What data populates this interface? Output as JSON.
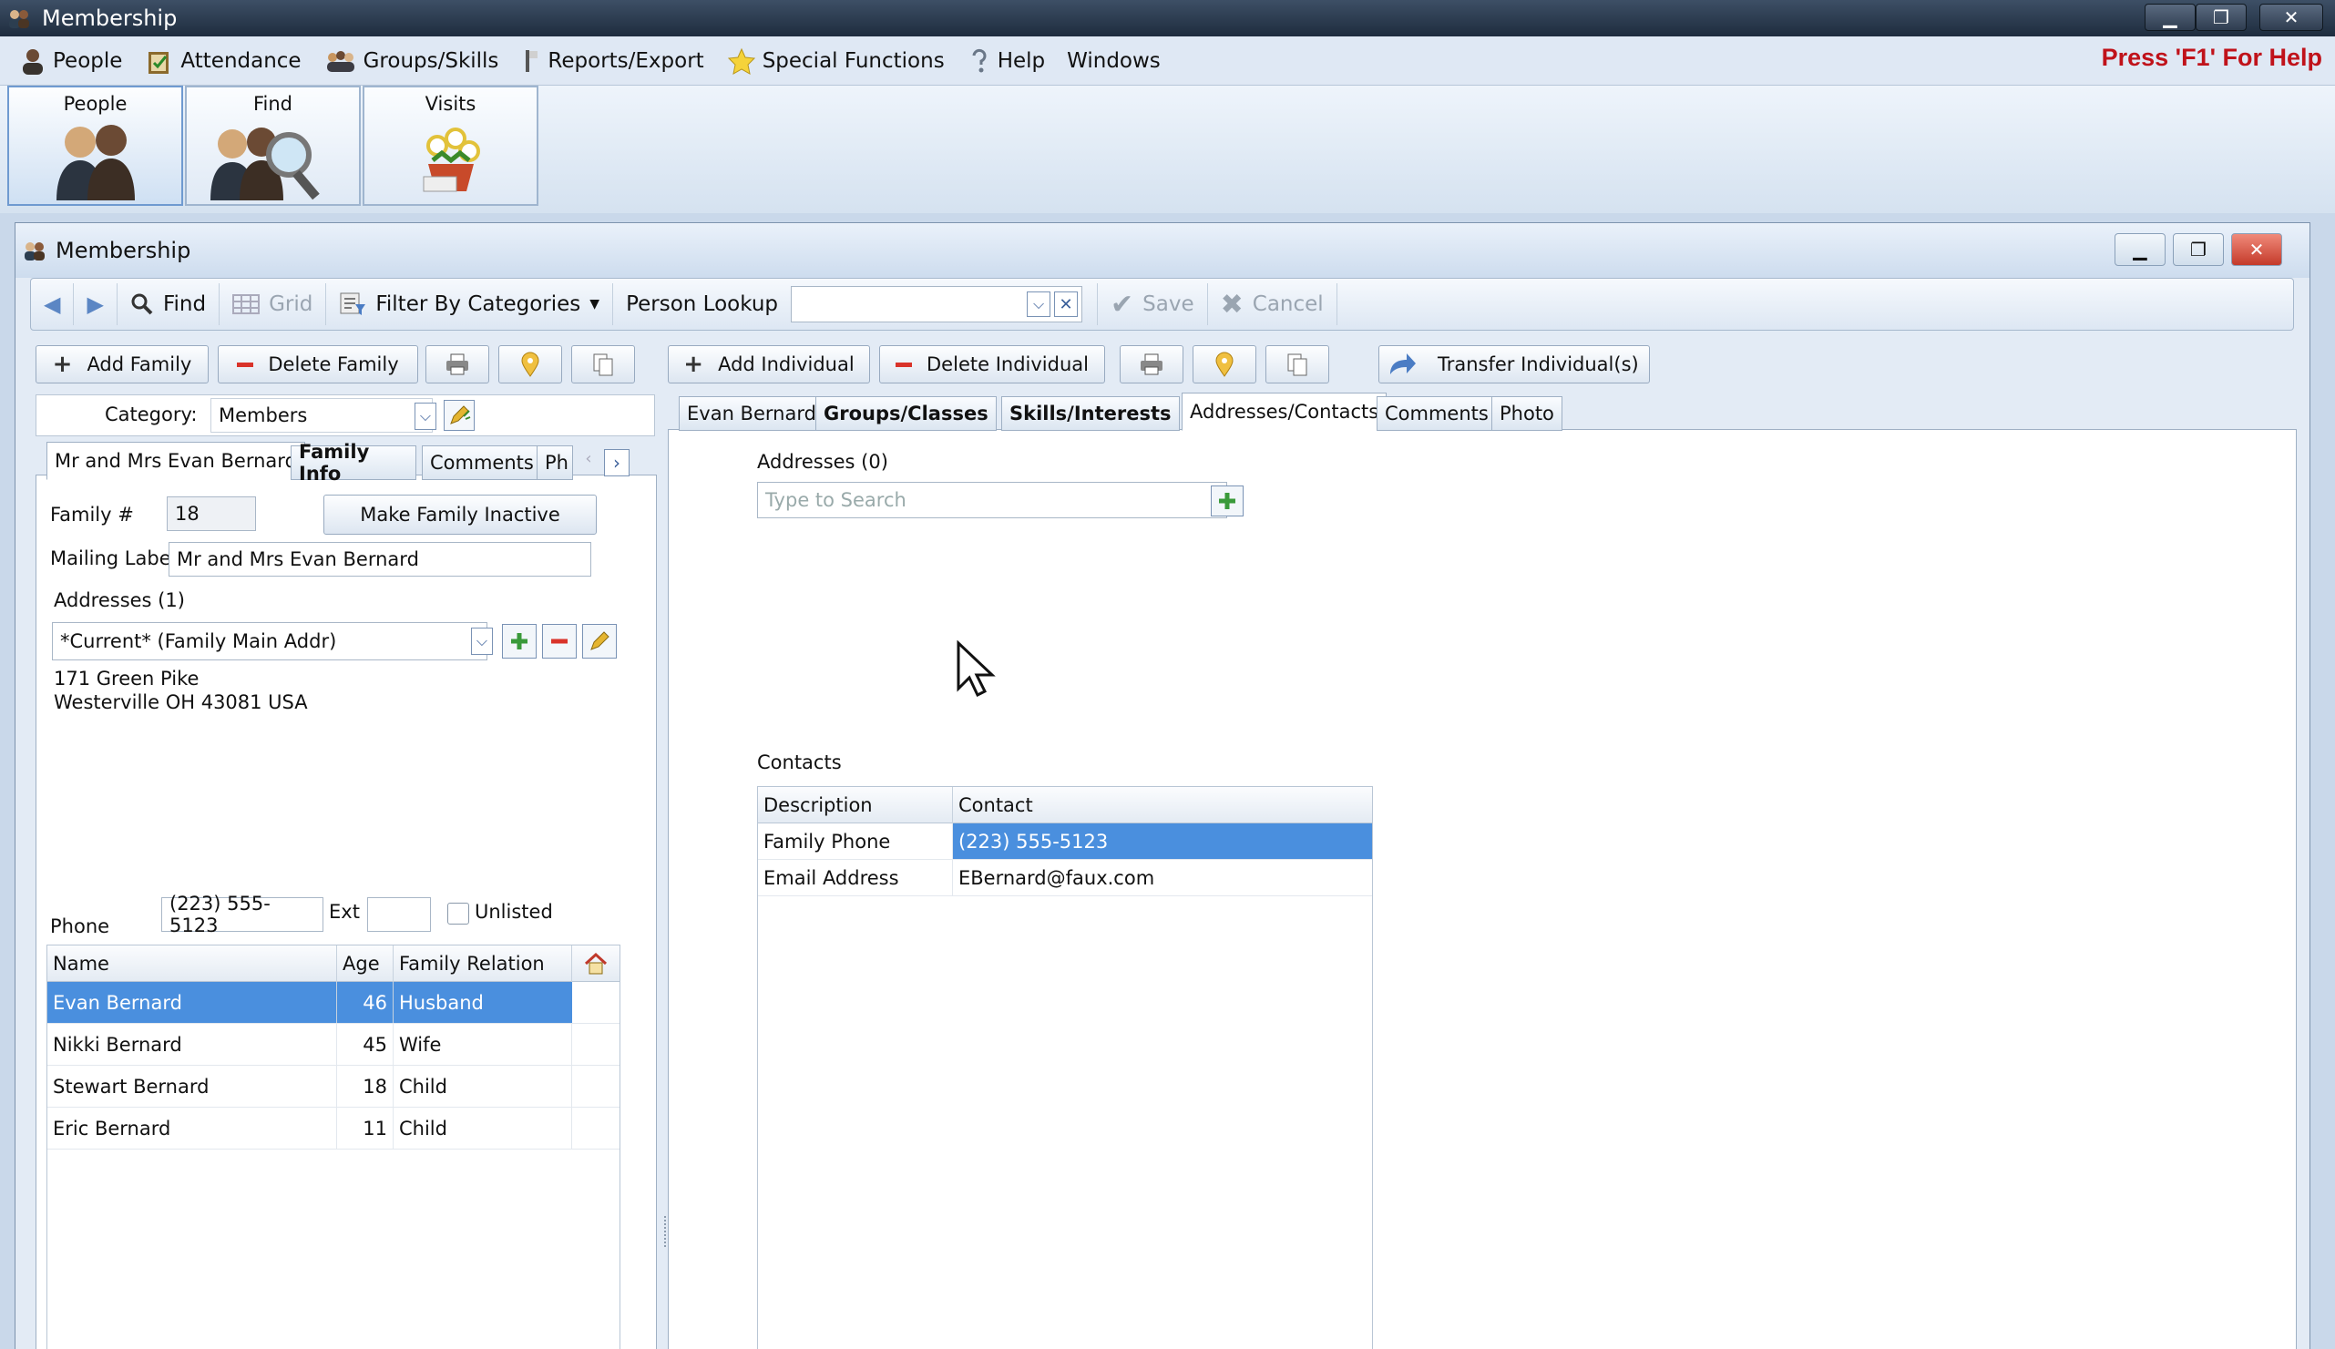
{
  "window": {
    "title": "Membership",
    "help_hint": "Press 'F1' For Help"
  },
  "menu": {
    "items": [
      "People",
      "Attendance",
      "Groups/Skills",
      "Reports/Export",
      "Special Functions",
      "Help",
      "Windows"
    ]
  },
  "launcher": {
    "buttons": [
      "People",
      "Find",
      "Visits"
    ]
  },
  "inner_window": {
    "title": "Membership"
  },
  "toolbar": {
    "find": "Find",
    "grid": "Grid",
    "filter": "Filter By Categories",
    "person_lookup": "Person Lookup",
    "save": "Save",
    "cancel": "Cancel"
  },
  "family": {
    "add": "Add Family",
    "delete": "Delete Family",
    "category_label": "Category:",
    "category_value": "Members",
    "tabs": [
      "Mr and Mrs Evan Bernard",
      "Family Info",
      "Comments",
      "Ph"
    ],
    "family_num_label": "Family #",
    "family_num": "18",
    "make_inactive": "Make Family Inactive",
    "mailing_label_label": "Mailing Label",
    "mailing_label": "Mr and Mrs Evan Bernard",
    "addresses_label": "Addresses (1)",
    "address_select": "*Current* (Family Main Addr)",
    "address_line1": "171 Green Pike",
    "address_line2": "Westerville OH  43081 USA",
    "phone_label": "Phone",
    "phone": "(223) 555-5123",
    "ext_label": "Ext",
    "ext": "",
    "unlisted_label": "Unlisted",
    "members_columns": [
      "Name",
      "Age",
      "Family Relation"
    ],
    "members": [
      {
        "name": "Evan Bernard",
        "age": "46",
        "relation": "Husband"
      },
      {
        "name": "Nikki Bernard",
        "age": "45",
        "relation": "Wife"
      },
      {
        "name": "Stewart Bernard",
        "age": "18",
        "relation": "Child"
      },
      {
        "name": "Eric Bernard",
        "age": "11",
        "relation": "Child"
      }
    ]
  },
  "individual": {
    "add": "Add Individual",
    "delete": "Delete Individual",
    "transfer": "Transfer Individual(s)",
    "tabs": [
      "Evan Bernard",
      "Groups/Classes",
      "Skills/Interests",
      "Addresses/Contacts",
      "Comments",
      "Photo"
    ],
    "addresses_label": "Addresses (0)",
    "search_placeholder": "Type to Search",
    "contacts_label": "Contacts",
    "contacts_columns": [
      "Description",
      "Contact"
    ],
    "contacts": [
      {
        "description": "Family Phone",
        "contact": "(223) 555-5123"
      },
      {
        "description": "Email Address",
        "contact": "EBernard@faux.com"
      }
    ]
  },
  "colors": {
    "accent": "#4a8fde",
    "help_red": "#c0121a",
    "titlebar": "#1e2c3e"
  }
}
